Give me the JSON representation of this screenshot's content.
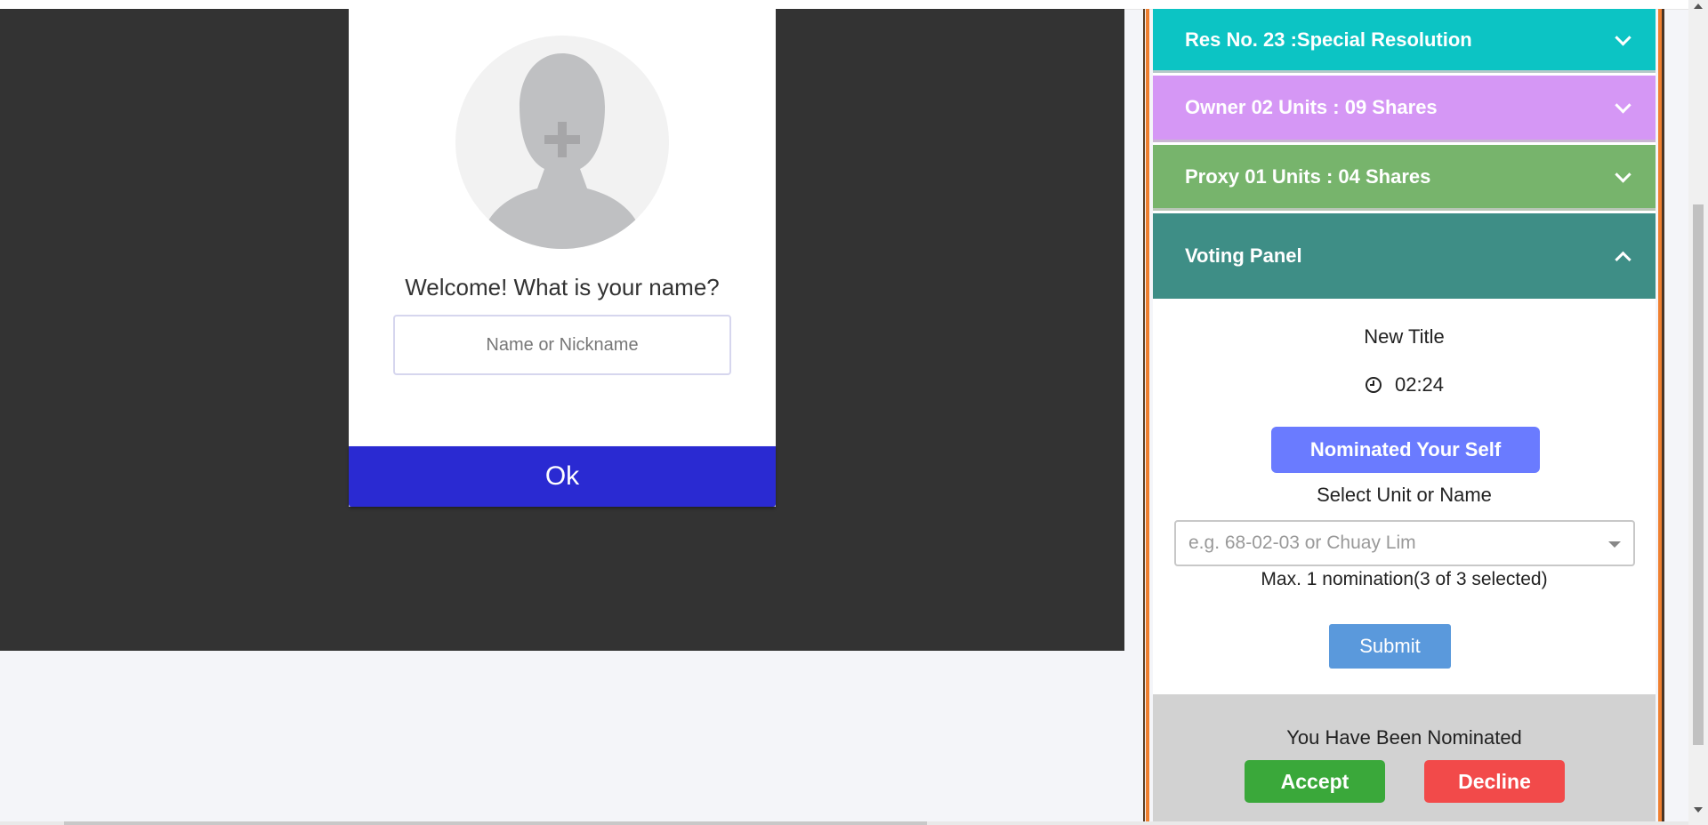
{
  "welcome": {
    "prompt": "Welcome! What is your name?",
    "name_placeholder": "Name or Nickname",
    "ok_label": "Ok"
  },
  "accordion": {
    "resolution": "Res No. 23 :Special Resolution",
    "owner": "Owner 02 Units : 09 Shares",
    "proxy": "Proxy 01 Units : 04 Shares",
    "voting_panel": "Voting Panel"
  },
  "voting": {
    "title": "New Title",
    "timer": "02:24",
    "nominate_label": "Nominated Your Self",
    "select_label": "Select Unit or Name",
    "select_placeholder": "e.g. 68-02-03 or Chuay Lim",
    "max_note": "Max. 1 nomination(3 of 3 selected)",
    "submit_label": "Submit"
  },
  "nomination": {
    "message": "You Have Been Nominated",
    "accept_label": "Accept",
    "decline_label": "Decline"
  },
  "colors": {
    "ok_button": "#2a2ad2",
    "resolution_header": "#0cc4c4",
    "owner_header": "#d597f5",
    "proxy_header": "#77b46c",
    "voting_header": "#3e8e86",
    "nominate_button": "#6a7bff",
    "submit_button": "#5a99dc",
    "accept_button": "#3aa83a",
    "decline_button": "#f24a4a",
    "panel_border": "#f08030"
  },
  "icons": {
    "avatar": "person-placeholder-icon",
    "accordion_collapsed": "chevron-down-icon",
    "accordion_expanded": "chevron-up-icon",
    "timer": "clock-icon",
    "select": "caret-down-icon"
  }
}
